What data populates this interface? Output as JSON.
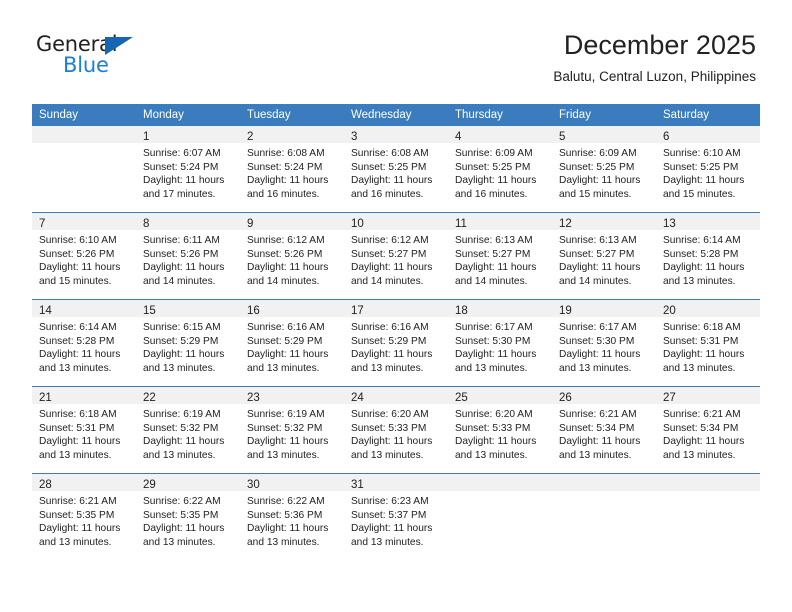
{
  "logo": {
    "text_top": "General",
    "text_bottom": "Blue",
    "triangle_icon": "triangle-icon",
    "color_dark": "#231f20",
    "color_blue": "#1b7fd4"
  },
  "header": {
    "title": "December 2025",
    "subtitle": "Balutu, Central Luzon, Philippines"
  },
  "theme": {
    "header_row_bg": "#3a7cbe",
    "header_row_text": "#ffffff",
    "daynum_band_bg": "#f1f1f1",
    "row_divider": "#3a7cbe",
    "cell_bg": "#ffffff",
    "text": "#222222"
  },
  "calendar": {
    "weekday_headers": [
      "Sunday",
      "Monday",
      "Tuesday",
      "Wednesday",
      "Thursday",
      "Friday",
      "Saturday"
    ],
    "weeks": [
      [
        {
          "day": "",
          "sunrise": "",
          "sunset": "",
          "daylight_1": "",
          "daylight_2": ""
        },
        {
          "day": "1",
          "sunrise": "Sunrise: 6:07 AM",
          "sunset": "Sunset: 5:24 PM",
          "daylight_1": "Daylight: 11 hours",
          "daylight_2": "and 17 minutes."
        },
        {
          "day": "2",
          "sunrise": "Sunrise: 6:08 AM",
          "sunset": "Sunset: 5:24 PM",
          "daylight_1": "Daylight: 11 hours",
          "daylight_2": "and 16 minutes."
        },
        {
          "day": "3",
          "sunrise": "Sunrise: 6:08 AM",
          "sunset": "Sunset: 5:25 PM",
          "daylight_1": "Daylight: 11 hours",
          "daylight_2": "and 16 minutes."
        },
        {
          "day": "4",
          "sunrise": "Sunrise: 6:09 AM",
          "sunset": "Sunset: 5:25 PM",
          "daylight_1": "Daylight: 11 hours",
          "daylight_2": "and 16 minutes."
        },
        {
          "day": "5",
          "sunrise": "Sunrise: 6:09 AM",
          "sunset": "Sunset: 5:25 PM",
          "daylight_1": "Daylight: 11 hours",
          "daylight_2": "and 15 minutes."
        },
        {
          "day": "6",
          "sunrise": "Sunrise: 6:10 AM",
          "sunset": "Sunset: 5:25 PM",
          "daylight_1": "Daylight: 11 hours",
          "daylight_2": "and 15 minutes."
        }
      ],
      [
        {
          "day": "7",
          "sunrise": "Sunrise: 6:10 AM",
          "sunset": "Sunset: 5:26 PM",
          "daylight_1": "Daylight: 11 hours",
          "daylight_2": "and 15 minutes."
        },
        {
          "day": "8",
          "sunrise": "Sunrise: 6:11 AM",
          "sunset": "Sunset: 5:26 PM",
          "daylight_1": "Daylight: 11 hours",
          "daylight_2": "and 14 minutes."
        },
        {
          "day": "9",
          "sunrise": "Sunrise: 6:12 AM",
          "sunset": "Sunset: 5:26 PM",
          "daylight_1": "Daylight: 11 hours",
          "daylight_2": "and 14 minutes."
        },
        {
          "day": "10",
          "sunrise": "Sunrise: 6:12 AM",
          "sunset": "Sunset: 5:27 PM",
          "daylight_1": "Daylight: 11 hours",
          "daylight_2": "and 14 minutes."
        },
        {
          "day": "11",
          "sunrise": "Sunrise: 6:13 AM",
          "sunset": "Sunset: 5:27 PM",
          "daylight_1": "Daylight: 11 hours",
          "daylight_2": "and 14 minutes."
        },
        {
          "day": "12",
          "sunrise": "Sunrise: 6:13 AM",
          "sunset": "Sunset: 5:27 PM",
          "daylight_1": "Daylight: 11 hours",
          "daylight_2": "and 14 minutes."
        },
        {
          "day": "13",
          "sunrise": "Sunrise: 6:14 AM",
          "sunset": "Sunset: 5:28 PM",
          "daylight_1": "Daylight: 11 hours",
          "daylight_2": "and 13 minutes."
        }
      ],
      [
        {
          "day": "14",
          "sunrise": "Sunrise: 6:14 AM",
          "sunset": "Sunset: 5:28 PM",
          "daylight_1": "Daylight: 11 hours",
          "daylight_2": "and 13 minutes."
        },
        {
          "day": "15",
          "sunrise": "Sunrise: 6:15 AM",
          "sunset": "Sunset: 5:29 PM",
          "daylight_1": "Daylight: 11 hours",
          "daylight_2": "and 13 minutes."
        },
        {
          "day": "16",
          "sunrise": "Sunrise: 6:16 AM",
          "sunset": "Sunset: 5:29 PM",
          "daylight_1": "Daylight: 11 hours",
          "daylight_2": "and 13 minutes."
        },
        {
          "day": "17",
          "sunrise": "Sunrise: 6:16 AM",
          "sunset": "Sunset: 5:29 PM",
          "daylight_1": "Daylight: 11 hours",
          "daylight_2": "and 13 minutes."
        },
        {
          "day": "18",
          "sunrise": "Sunrise: 6:17 AM",
          "sunset": "Sunset: 5:30 PM",
          "daylight_1": "Daylight: 11 hours",
          "daylight_2": "and 13 minutes."
        },
        {
          "day": "19",
          "sunrise": "Sunrise: 6:17 AM",
          "sunset": "Sunset: 5:30 PM",
          "daylight_1": "Daylight: 11 hours",
          "daylight_2": "and 13 minutes."
        },
        {
          "day": "20",
          "sunrise": "Sunrise: 6:18 AM",
          "sunset": "Sunset: 5:31 PM",
          "daylight_1": "Daylight: 11 hours",
          "daylight_2": "and 13 minutes."
        }
      ],
      [
        {
          "day": "21",
          "sunrise": "Sunrise: 6:18 AM",
          "sunset": "Sunset: 5:31 PM",
          "daylight_1": "Daylight: 11 hours",
          "daylight_2": "and 13 minutes."
        },
        {
          "day": "22",
          "sunrise": "Sunrise: 6:19 AM",
          "sunset": "Sunset: 5:32 PM",
          "daylight_1": "Daylight: 11 hours",
          "daylight_2": "and 13 minutes."
        },
        {
          "day": "23",
          "sunrise": "Sunrise: 6:19 AM",
          "sunset": "Sunset: 5:32 PM",
          "daylight_1": "Daylight: 11 hours",
          "daylight_2": "and 13 minutes."
        },
        {
          "day": "24",
          "sunrise": "Sunrise: 6:20 AM",
          "sunset": "Sunset: 5:33 PM",
          "daylight_1": "Daylight: 11 hours",
          "daylight_2": "and 13 minutes."
        },
        {
          "day": "25",
          "sunrise": "Sunrise: 6:20 AM",
          "sunset": "Sunset: 5:33 PM",
          "daylight_1": "Daylight: 11 hours",
          "daylight_2": "and 13 minutes."
        },
        {
          "day": "26",
          "sunrise": "Sunrise: 6:21 AM",
          "sunset": "Sunset: 5:34 PM",
          "daylight_1": "Daylight: 11 hours",
          "daylight_2": "and 13 minutes."
        },
        {
          "day": "27",
          "sunrise": "Sunrise: 6:21 AM",
          "sunset": "Sunset: 5:34 PM",
          "daylight_1": "Daylight: 11 hours",
          "daylight_2": "and 13 minutes."
        }
      ],
      [
        {
          "day": "28",
          "sunrise": "Sunrise: 6:21 AM",
          "sunset": "Sunset: 5:35 PM",
          "daylight_1": "Daylight: 11 hours",
          "daylight_2": "and 13 minutes."
        },
        {
          "day": "29",
          "sunrise": "Sunrise: 6:22 AM",
          "sunset": "Sunset: 5:35 PM",
          "daylight_1": "Daylight: 11 hours",
          "daylight_2": "and 13 minutes."
        },
        {
          "day": "30",
          "sunrise": "Sunrise: 6:22 AM",
          "sunset": "Sunset: 5:36 PM",
          "daylight_1": "Daylight: 11 hours",
          "daylight_2": "and 13 minutes."
        },
        {
          "day": "31",
          "sunrise": "Sunrise: 6:23 AM",
          "sunset": "Sunset: 5:37 PM",
          "daylight_1": "Daylight: 11 hours",
          "daylight_2": "and 13 minutes."
        },
        {
          "day": "",
          "sunrise": "",
          "sunset": "",
          "daylight_1": "",
          "daylight_2": ""
        },
        {
          "day": "",
          "sunrise": "",
          "sunset": "",
          "daylight_1": "",
          "daylight_2": ""
        },
        {
          "day": "",
          "sunrise": "",
          "sunset": "",
          "daylight_1": "",
          "daylight_2": ""
        }
      ]
    ]
  }
}
